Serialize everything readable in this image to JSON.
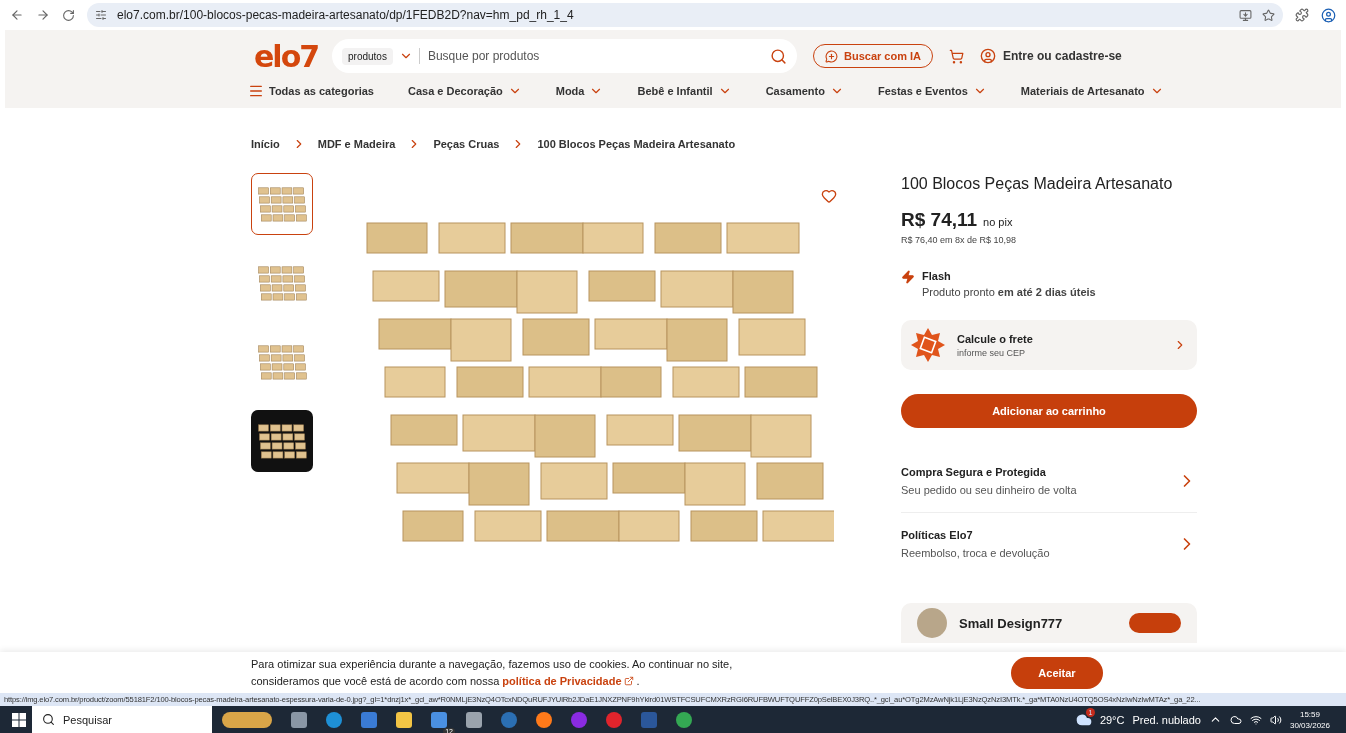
{
  "browser": {
    "url": "elo7.com.br/100-blocos-pecas-madeira-artesanato/dp/1FEDB2D?nav=hm_pd_rh_1_4",
    "status_url": "https://img.elo7.com.br/product/zoom/55181F2/100-blocos-pecas-madeira-artesanato-espessura-varia-de-0.jpg?_gl=1*dnzj1x*_gcl_aw*R0NMLjE3NzQ4OTcxNDQuRUFJYUlRb2JDaE1JNXZPNF9hYklrd01WSTFCSUFCMXRzRGI6RUFBWUFTQUFFZ0pSelBEX0J3RQ..*_gcl_au*OTg2MzAwNjk1LjE3NzQzNzI3MTk.*_ga*MTA0NzU4OTQ5OS4xNzIwNzIwMTAz*_ga_22..."
  },
  "header": {
    "logo": "elo7",
    "search": {
      "scope": "produtos",
      "placeholder": "Busque por produtos"
    },
    "ai_button": "Buscar com IA",
    "account_link": "Entre ou cadastre-se",
    "categories": [
      {
        "label": "Todas as categorias",
        "kind": "menu"
      },
      {
        "label": "Casa e Decoração",
        "kind": "dropdown"
      },
      {
        "label": "Moda",
        "kind": "dropdown"
      },
      {
        "label": "Bebê e Infantil",
        "kind": "dropdown"
      },
      {
        "label": "Casamento",
        "kind": "dropdown"
      },
      {
        "label": "Festas e Eventos",
        "kind": "dropdown"
      },
      {
        "label": "Materiais de Artesanato",
        "kind": "dropdown"
      }
    ]
  },
  "breadcrumb": [
    "Início",
    "MDF e Madeira",
    "Peças Cruas",
    "100 Blocos Peças Madeira Artesanato"
  ],
  "gallery": {
    "favorited": false,
    "thumbnails": [
      {
        "selected": true
      },
      {
        "selected": false
      },
      {
        "selected": false
      },
      {
        "selected": false
      }
    ]
  },
  "product": {
    "title": "100 Blocos Peças Madeira Artesanato",
    "price": "R$ 74,11",
    "price_suffix": "no pix",
    "installments": "R$ 76,40 em 8x de R$ 10,98",
    "delivery": {
      "title": "Flash",
      "text": "Produto pronto **em até 2 dias úteis**"
    },
    "shipping": {
      "title": "Calcule o frete",
      "subtitle": "informe seu CEP"
    },
    "add_to_cart": "Adicionar ao carrinho",
    "info_rows": [
      {
        "title": "Compra Segura e Protegida",
        "subtitle": "Seu pedido ou seu dinheiro de volta"
      },
      {
        "title": "Políticas Elo7",
        "subtitle": "Reembolso, troca e devolução"
      }
    ],
    "seller": {
      "name": "Small Design777"
    }
  },
  "cookie": {
    "text": "Para otimizar sua experiência durante a navegação, fazemos uso de cookies. Ao continuar no site, consideramos que você está de acordo com nossa",
    "link": "política de Privacidade",
    "end": ".",
    "button": "Aceitar"
  },
  "taskbar": {
    "search_placeholder": "Pesquisar",
    "mail_badge": "12",
    "weather": {
      "badge": "1",
      "temp": "29°C",
      "condition": "Pred. nublado"
    },
    "time": "15:59",
    "date": "30/03/2026"
  }
}
